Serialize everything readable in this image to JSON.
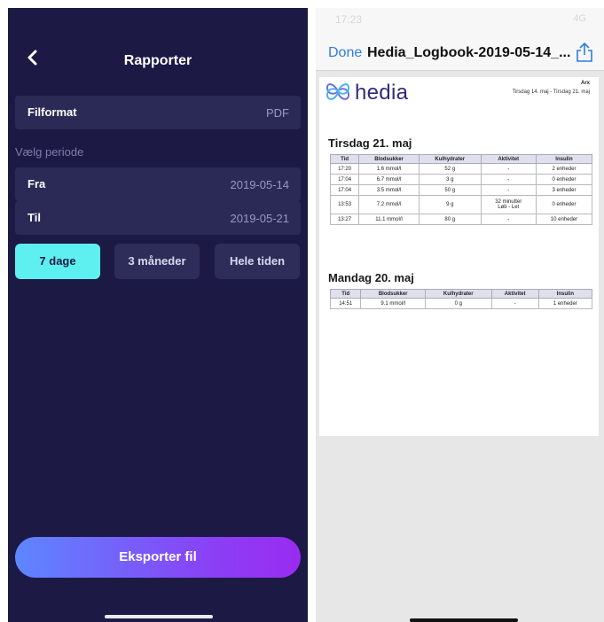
{
  "left": {
    "title": "Rapporter",
    "fileformat": {
      "label": "Filformat",
      "value": "PDF"
    },
    "period_label": "Vælg periode",
    "from": {
      "label": "Fra",
      "value": "2019-05-14"
    },
    "to": {
      "label": "Til",
      "value": "2019-05-21"
    },
    "ranges": [
      "7 dage",
      "3 måneder",
      "Hele tiden"
    ],
    "selected_range": "7 dage",
    "export_label": "Eksporter fil",
    "colors": {
      "background": "#1c1a45",
      "row": "#2b2a57",
      "active": "#5ef0f0"
    }
  },
  "right": {
    "status_time": "17:23",
    "status_right": "4G",
    "done_label": "Done",
    "filename": "Hedia_Logbook-2019-05-14_...",
    "brand": "hedia",
    "user": "Arx",
    "range": "Tirsdag 14. maj - Tirsdag 21. maj",
    "columns": [
      "Tid",
      "Blodsukker",
      "Kulhydrater",
      "Aktivitet",
      "Insulin"
    ],
    "days": [
      {
        "title": "Tirsdag 21. maj",
        "rows": [
          [
            "17:20",
            "1.6 mmol/l",
            "52 g",
            "-",
            "2 enheder"
          ],
          [
            "17:04",
            "6.7 mmol/l",
            "3 g",
            "-",
            "0 enheder"
          ],
          [
            "17:04",
            "3.5 mmol/l",
            "50 g",
            "-",
            "3 enheder"
          ],
          [
            "13:53",
            "7.2 mmol/l",
            "9 g",
            "32 minutter",
            "0 enheder"
          ],
          [
            "13:27",
            "11.1 mmol/l",
            "80 g",
            "-",
            "10 enheder"
          ]
        ],
        "activity_detail": "Løb - Let"
      },
      {
        "title": "Mandag 20. maj",
        "rows": [
          [
            "14:51",
            "9.1 mmol/l",
            "0 g",
            "-",
            "1 enheder"
          ]
        ]
      }
    ]
  }
}
